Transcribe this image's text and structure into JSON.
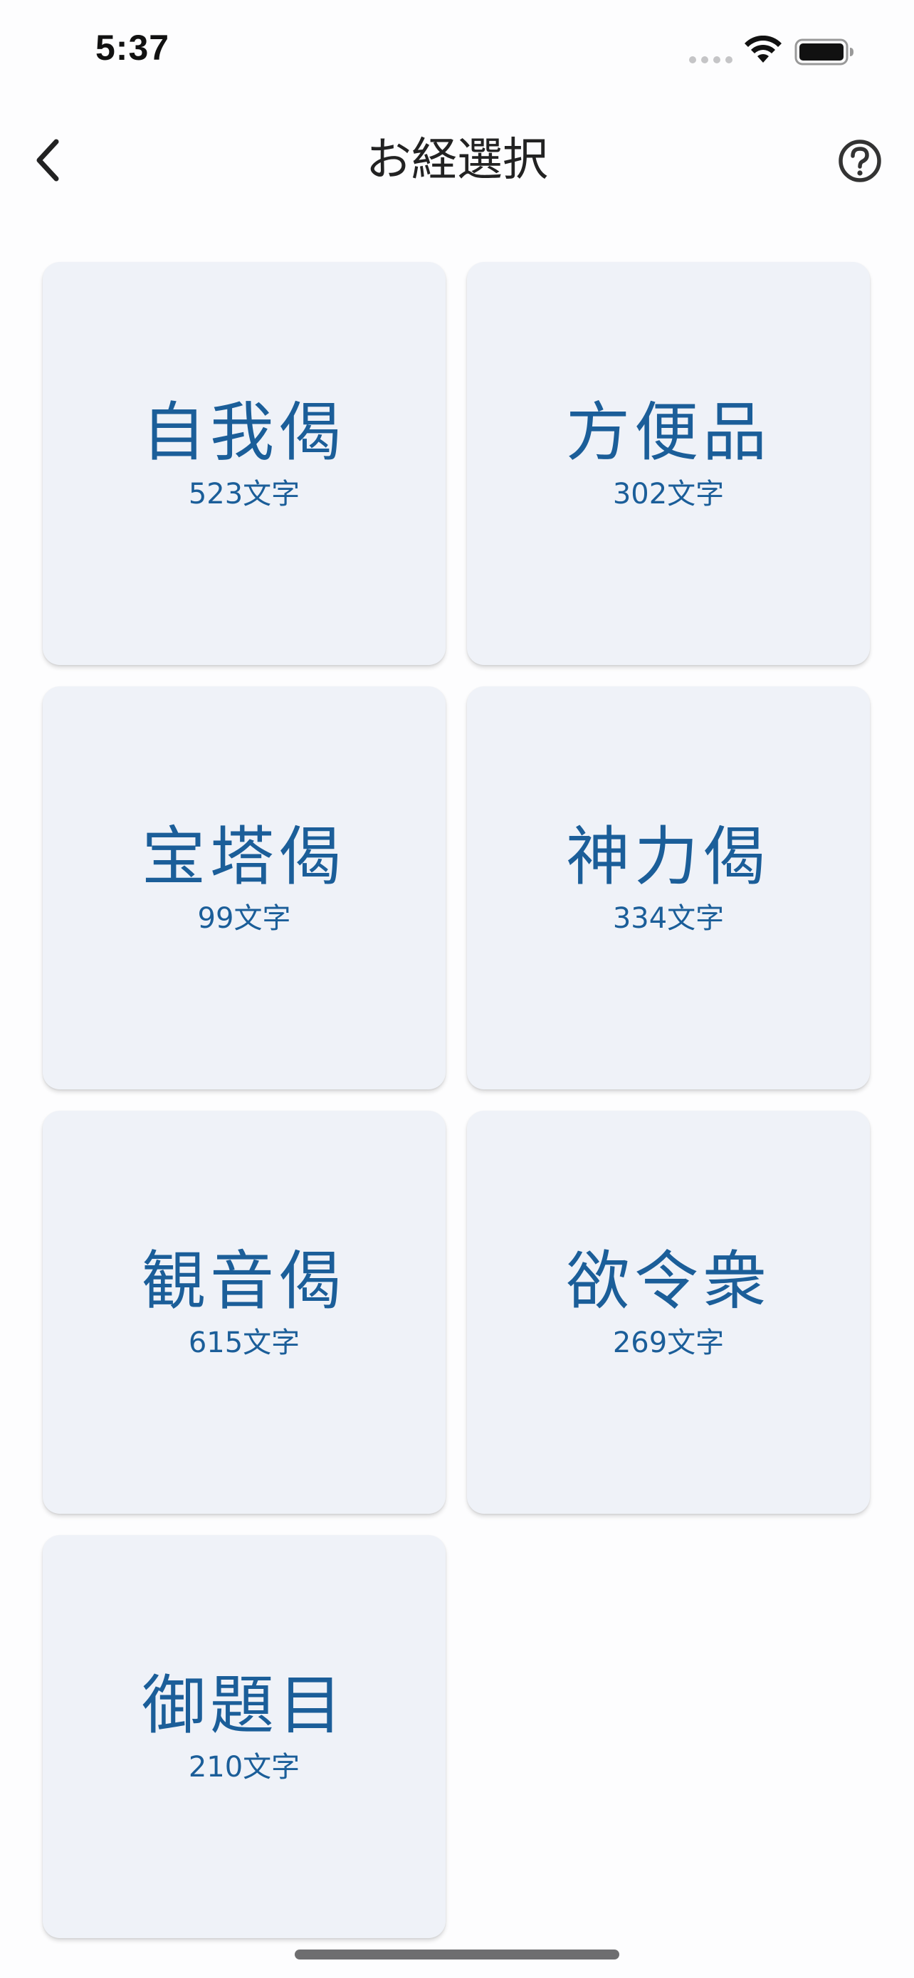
{
  "status_bar": {
    "time": "5:37"
  },
  "nav": {
    "title": "お経選択",
    "back_icon": "chevron-left-icon",
    "help_icon": "question-circle-icon"
  },
  "colors": {
    "accent": "#1b5e99",
    "card_background": "#eff2f8"
  },
  "sutras": [
    {
      "title": "自我偈",
      "count": "523文字"
    },
    {
      "title": "方便品",
      "count": "302文字"
    },
    {
      "title": "宝塔偈",
      "count": "99文字"
    },
    {
      "title": "神力偈",
      "count": "334文字"
    },
    {
      "title": "観音偈",
      "count": "615文字"
    },
    {
      "title": "欲令衆",
      "count": "269文字"
    },
    {
      "title": "御題目",
      "count": "210文字"
    }
  ]
}
